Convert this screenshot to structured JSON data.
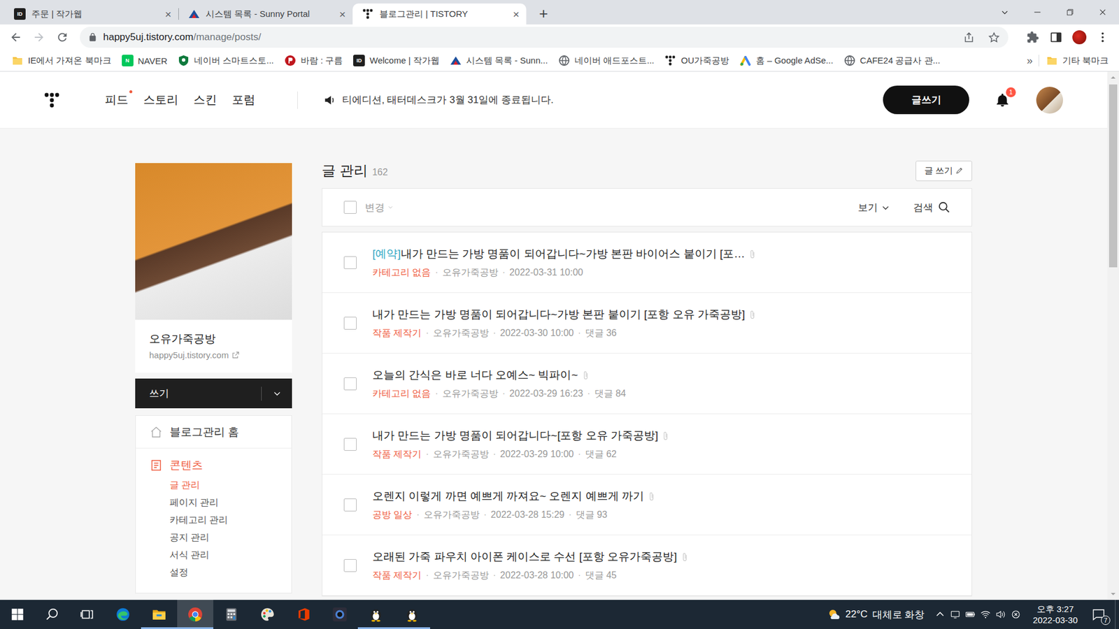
{
  "browser": {
    "tabs": [
      {
        "label": "주문 | 작가웹",
        "kind": "letter",
        "icon": "ID",
        "color": "#1f1f1f",
        "selected": false
      },
      {
        "label": "시스템 목록 - Sunny Portal",
        "kind": "sunny",
        "selected": false
      },
      {
        "label": "블로그관리 | TISTORY",
        "kind": "tistory",
        "selected": true
      }
    ],
    "close_icon": "×",
    "new_tab": "+",
    "url_domain": "happy5uj.tistory.com",
    "url_path": "/manage/posts/",
    "bookmarks": [
      {
        "label": "IE에서 가져온 북마크",
        "kind": "folder"
      },
      {
        "label": "NAVER",
        "kind": "letter",
        "icon": "N",
        "color": "#03c75a"
      },
      {
        "label": "네이버 스마트스토...",
        "kind": "shield"
      },
      {
        "label": "바람 : 구름",
        "kind": "baram"
      },
      {
        "label": "Welcome | 작가웹",
        "kind": "letter",
        "icon": "ID",
        "color": "#1f1f1f"
      },
      {
        "label": "시스템 목록 - Sunn...",
        "kind": "sunny"
      },
      {
        "label": "네이버 애드포스트...",
        "kind": "globe"
      },
      {
        "label": "OU가죽공방",
        "kind": "tistory"
      },
      {
        "label": "홈 – Google AdSe...",
        "kind": "adsense"
      },
      {
        "label": "CAFE24 공급사 관...",
        "kind": "globe"
      }
    ],
    "more_bookmarks": "»",
    "other_bookmarks": "기타 북마크"
  },
  "blog": {
    "header": {
      "nav": [
        {
          "label": "피드",
          "new": true
        },
        {
          "label": "스토리",
          "new": false
        },
        {
          "label": "스킨",
          "new": false
        },
        {
          "label": "포럼",
          "new": false
        }
      ],
      "notice": "티에디션, 태터데스크가 3월 31일에 종료됩니다.",
      "write_button": "글쓰기",
      "notification_count": "1"
    },
    "sidebar": {
      "blog_name": "오유가죽공방",
      "blog_url": "happy5uj.tistory.com",
      "write": "쓰기",
      "home": "블로그관리 홈",
      "section": "콘텐츠",
      "items": [
        {
          "label": "글 관리",
          "selected": true
        },
        {
          "label": "페이지 관리",
          "selected": false
        },
        {
          "label": "카테고리 관리",
          "selected": false
        },
        {
          "label": "공지 관리",
          "selected": false
        },
        {
          "label": "서식 관리",
          "selected": false
        },
        {
          "label": "설정",
          "selected": false
        }
      ]
    },
    "posts_panel": {
      "title": "글 관리",
      "count": "162",
      "write_button": "글 쓰기",
      "select_all_checked": false,
      "change": "변경",
      "change_disabled": true,
      "view": "보기",
      "search": "검색",
      "separator": "·",
      "posts": [
        {
          "tag": "[예약]",
          "title": "내가 만드는 가방 명품이 되어갑니다~가방 본판 바이어스 붙이기 [포…",
          "category": "카테고리 없음",
          "author": "오유가죽공방",
          "date": "2022-03-31 10:00",
          "checked": false
        },
        {
          "title": "내가 만드는 가방 명품이 되어갑니다~가방 본판 붙이기 [포항 오유 가죽공방]",
          "category": "작품 제작기",
          "author": "오유가죽공방",
          "date": "2022-03-30 10:00",
          "comments": "댓글 36",
          "checked": false
        },
        {
          "title": "오늘의 간식은 바로 너다 오예스~ 빅파이~",
          "category": "카테고리 없음",
          "author": "오유가죽공방",
          "date": "2022-03-29 16:23",
          "comments": "댓글 84",
          "checked": false
        },
        {
          "title": "내가 만드는 가방 명품이 되어갑니다~[포항 오유 가죽공방]",
          "category": "작품 제작기",
          "author": "오유가죽공방",
          "date": "2022-03-29 10:00",
          "comments": "댓글 62",
          "checked": false
        },
        {
          "title": "오렌지 이렇게 까면 예쁘게 까져요~ 오렌지 예쁘게 까기",
          "category": "공방 일상",
          "author": "오유가죽공방",
          "date": "2022-03-28 15:29",
          "comments": "댓글 93",
          "checked": false
        },
        {
          "title": "오래된 가죽 파우치 아이폰 케이스로 수선 [포항 오유가죽공방]",
          "category": "작품 제작기",
          "author": "오유가죽공방",
          "date": "2022-03-28 10:00",
          "comments": "댓글 45",
          "checked": false
        }
      ]
    }
  },
  "taskbar": {
    "apps": [
      {
        "kind": "edge",
        "running": false,
        "selected": false
      },
      {
        "kind": "explorer",
        "running": true,
        "selected": false
      },
      {
        "kind": "chrome",
        "running": true,
        "selected": true
      },
      {
        "kind": "calculator",
        "running": false,
        "selected": false
      },
      {
        "kind": "paint",
        "running": false,
        "selected": false
      },
      {
        "kind": "office",
        "running": false,
        "selected": false
      },
      {
        "kind": "camera",
        "running": false,
        "selected": false
      },
      {
        "kind": "penguin",
        "running": true,
        "selected": false
      },
      {
        "kind": "penguin",
        "running": true,
        "selected": false
      }
    ],
    "weather": {
      "temp": "22°C",
      "text": "대체로 화창"
    },
    "time": "오후 3:27",
    "date": "2022-03-30",
    "notifications": "7"
  }
}
